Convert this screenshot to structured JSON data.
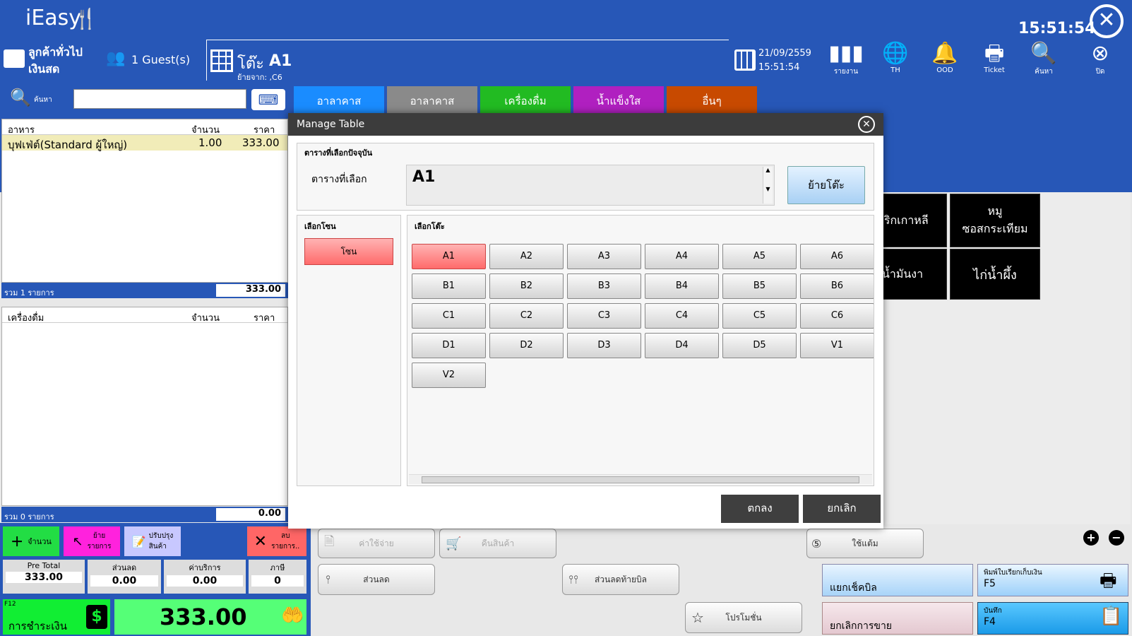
{
  "app": {
    "logo": "iEasy",
    "clock": "15:51:54"
  },
  "customer": {
    "name": "ลูกค้าทั่วไป",
    "type": "เงินสด",
    "guests": "1 Guest(s)"
  },
  "table": {
    "prefix": "โต๊ะ",
    "name": "A1",
    "moved_from": "ย้ายจาก: ,C6"
  },
  "date": {
    "date": "21/09/2559",
    "time": "15:51:54"
  },
  "top_icons": [
    {
      "label": "รายงาน",
      "icon": "bar-chart-icon"
    },
    {
      "label": "TH",
      "icon": "globe-icon"
    },
    {
      "label": "OOD",
      "icon": "bell-icon"
    },
    {
      "label": "Ticket",
      "icon": "printer-icon"
    },
    {
      "label": "ค้นหา",
      "icon": "search-icon"
    },
    {
      "label": "ปิด",
      "icon": "close-icon"
    }
  ],
  "search": {
    "label": "ค้นหา"
  },
  "categories": [
    {
      "label": "อาลาคาส",
      "color": "#1a8cff"
    },
    {
      "label": "อาลาคาส",
      "color": "#8a8a8a"
    },
    {
      "label": "เครื่องดื่ม",
      "color": "#22bb22"
    },
    {
      "label": "น้ำแข็งใส",
      "color": "#b020c0"
    },
    {
      "label": "อื่นๆ",
      "color": "#c84a00"
    }
  ],
  "food_panel": {
    "headers": [
      "อาหาร",
      "จำนวน",
      "ราคา"
    ],
    "rows": [
      {
        "name": "บุฟเฟ่ต์(Standard ผู้ใหญ่)",
        "qty": "1.00",
        "price": "333.00"
      }
    ],
    "summary_label": "รวม 1 รายการ",
    "summary_value": "333.00"
  },
  "drink_panel": {
    "headers": [
      "เครื่องดื่ม",
      "จำนวน",
      "ราคา"
    ],
    "summary_label": "รวม 0 รายการ",
    "summary_value": "0.00"
  },
  "action_buttons": [
    {
      "label": "จำนวน",
      "color": "#22dd44"
    },
    {
      "label": "ย้าย\nรายการ",
      "color": "#ff22dd"
    },
    {
      "label": "ปรับปรุง\nสินค้า",
      "color": "#c8c8ff"
    },
    {
      "label": "ลบ\nรายการ..",
      "color": "#ff6666"
    }
  ],
  "totals": [
    {
      "label": "Pre Total",
      "value": "333.00"
    },
    {
      "label": "ส่วนลด",
      "value": "0.00"
    },
    {
      "label": "ค่าบริการ",
      "value": "0.00"
    },
    {
      "label": "ภาษี",
      "value": "0"
    }
  ],
  "pay": {
    "key": "F12",
    "label": "การชำระเงิน",
    "amount": "333.00"
  },
  "menu_tiles": [
    "พริกเกาหลี",
    "หมู\nซอสกระเทียม",
    "น้ำมันงา",
    "ไก่น้ำผึ้ง"
  ],
  "bottom_buttons": {
    "expense": "ค่าใช้จ่าย",
    "return": "คืนสินค้า",
    "stamp": "ใช้แต้ม",
    "discount": "ส่วนลด",
    "bill_discount": "ส่วนลดท้ายบิล",
    "promotion": "โปรโมชั่น",
    "split": "แยกเช็คบิล",
    "cancel_sale": "ยกเลิกการขาย",
    "print_label": "พิมพ์ใบเรียกเก็บเงิน",
    "print_key": "F5",
    "save_label": "บันทึก",
    "save_key": "F4"
  },
  "modal": {
    "title": "Manage Table",
    "current_section": "ตารางที่เลือกปัจจุบัน",
    "selected_label": "ตารางที่เลือก",
    "selected_value": "A1",
    "move_button": "ย้ายโต๊ะ",
    "zone_section": "เลือกโซน",
    "zone_button": "โซน",
    "table_section": "เลือกโต๊ะ",
    "tables": [
      "A1",
      "A2",
      "A3",
      "A4",
      "A5",
      "A6",
      "B1",
      "B2",
      "B3",
      "B4",
      "B5",
      "B6",
      "C1",
      "C2",
      "C3",
      "C4",
      "C5",
      "C6",
      "D1",
      "D2",
      "D3",
      "D4",
      "D5",
      "V1",
      "V2"
    ],
    "selected_table": "A1",
    "ok": "ตกลง",
    "cancel": "ยกเลิก"
  }
}
